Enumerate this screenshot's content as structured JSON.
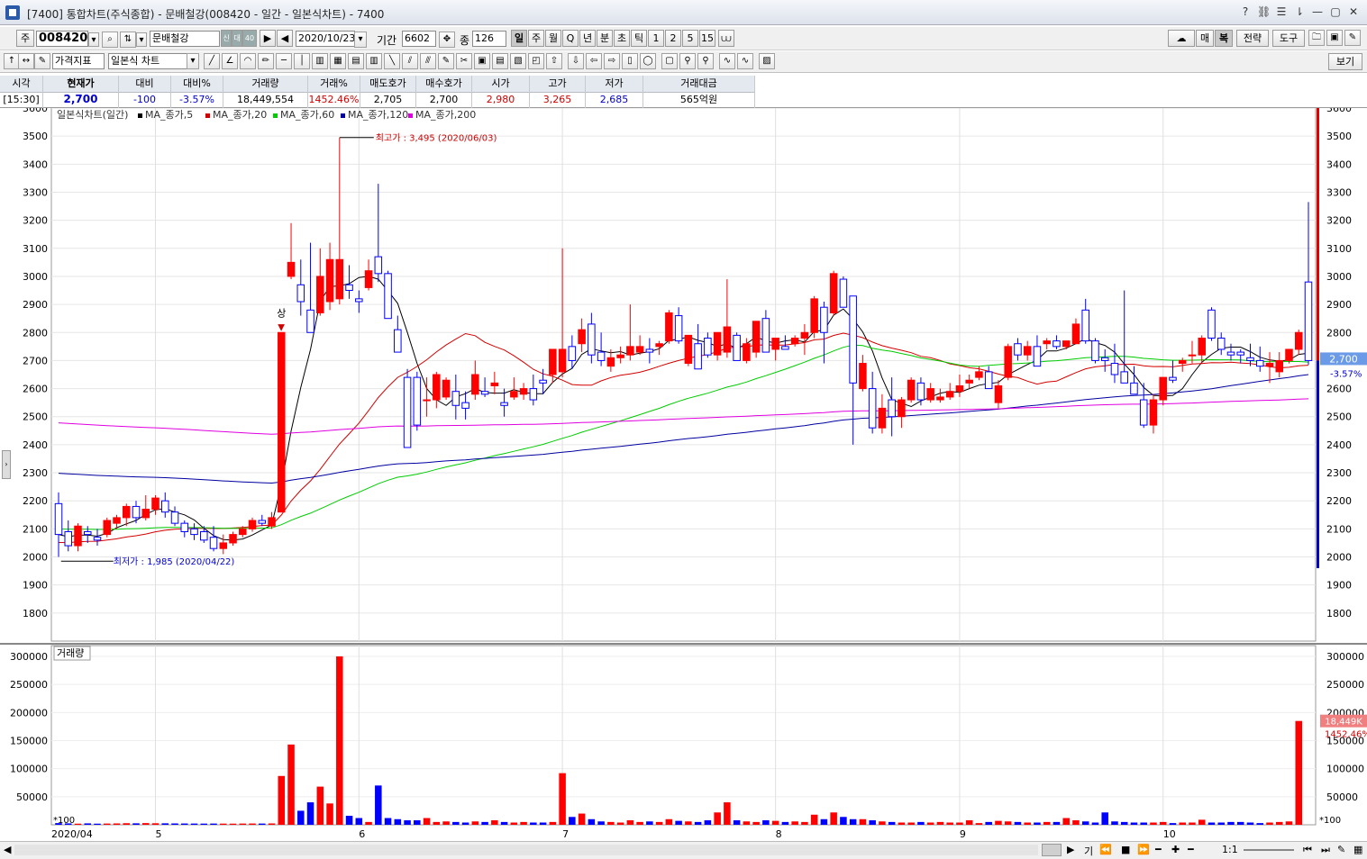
{
  "window": {
    "title": "[7400] 통합차트(주식종합) - 문배철강(008420 - 일간 - 일본식차트) - 7400"
  },
  "toolbar1": {
    "market_btn": "주",
    "code": "008420",
    "stock_name": "문배철강",
    "badge1": "신",
    "badge2": "대",
    "badge3": "40",
    "date": "2020/10/23",
    "period_label": "기간",
    "period_value": "6602",
    "count_label": "종",
    "count_value": "126",
    "period_buttons": [
      "일",
      "주",
      "월",
      "Q",
      "년",
      "분",
      "초",
      "틱",
      "1",
      "2",
      "5",
      "15"
    ],
    "right_buttons": [
      "매",
      "복",
      "전략",
      "도구"
    ]
  },
  "toolbar2": {
    "indicator_select": "가격지표",
    "chart_type_select": "일본식 차트",
    "view_button": "보기"
  },
  "quote": {
    "headers": [
      "시각",
      "현재가",
      "대비",
      "대비%",
      "거래량",
      "거래%",
      "매도호가",
      "매수호가",
      "시가",
      "고가",
      "저가",
      "거래대금"
    ],
    "values": [
      "[15:30]",
      "2,700",
      "-100",
      "-3.57%",
      "18,449,554",
      "1452.46%",
      "2,705",
      "2,700",
      "2,980",
      "3,265",
      "2,685",
      "565억원"
    ]
  },
  "colors": {
    "up": "#ff0000",
    "down": "#0000ff",
    "ma5": "#000000",
    "ma20": "#d40000",
    "ma60": "#00cc00",
    "ma120": "#0000a0",
    "ma200": "#e000e0"
  },
  "chart_data": {
    "type": "candlestick",
    "title": "일본식차트(일간)",
    "legend": [
      "MA_종가,5",
      "MA_종가,20",
      "MA_종가,60",
      "MA_종가,120",
      "MA_종가,200"
    ],
    "x_labels": [
      "2020/04",
      "5",
      "6",
      "7",
      "8",
      "9",
      "10"
    ],
    "ylim": [
      1700,
      3600
    ],
    "y_ticks": [
      1800,
      1900,
      2000,
      2100,
      2200,
      2300,
      2400,
      2500,
      2600,
      2700,
      2800,
      2900,
      3000,
      3100,
      3200,
      3300,
      3400,
      3500,
      3600
    ],
    "annotations": {
      "high": "최고가 : 3,495 (2020/06/03)",
      "low": "최저가 : 1,985 (2020/04/22)",
      "limit_up": "상"
    },
    "current_price": "2,700",
    "current_change": "-3.57%",
    "candles": [
      [
        2190,
        2230,
        2000,
        2080
      ],
      [
        2090,
        2130,
        2020,
        2040
      ],
      [
        2040,
        2120,
        2020,
        2110
      ],
      [
        2090,
        2110,
        2050,
        2080
      ],
      [
        2070,
        2100,
        2040,
        2060
      ],
      [
        2080,
        2140,
        2070,
        2130
      ],
      [
        2120,
        2150,
        2100,
        2140
      ],
      [
        2140,
        2190,
        2110,
        2180
      ],
      [
        2180,
        2200,
        2120,
        2140
      ],
      [
        2140,
        2220,
        2130,
        2170
      ],
      [
        2170,
        2220,
        2150,
        2210
      ],
      [
        2200,
        2230,
        2140,
        2160
      ],
      [
        2160,
        2180,
        2110,
        2120
      ],
      [
        2120,
        2130,
        2070,
        2090
      ],
      [
        2100,
        2120,
        2060,
        2080
      ],
      [
        2090,
        2110,
        2050,
        2060
      ],
      [
        2070,
        2110,
        2020,
        2030
      ],
      [
        2030,
        2080,
        2010,
        2050
      ],
      [
        2050,
        2090,
        2040,
        2080
      ],
      [
        2080,
        2110,
        2070,
        2100
      ],
      [
        2100,
        2140,
        2090,
        2130
      ],
      [
        2130,
        2150,
        2110,
        2120
      ],
      [
        2110,
        2160,
        2100,
        2140
      ],
      [
        2160,
        2800,
        2160,
        2800
      ],
      [
        3000,
        3190,
        2990,
        3050
      ],
      [
        2970,
        3060,
        2860,
        2910
      ],
      [
        2880,
        3120,
        2850,
        2800
      ],
      [
        2870,
        3100,
        2860,
        3000
      ],
      [
        2910,
        3120,
        2880,
        3060
      ],
      [
        2920,
        3495,
        2900,
        3060
      ],
      [
        2970,
        3040,
        2920,
        2950
      ],
      [
        2920,
        2950,
        2870,
        2910
      ],
      [
        2960,
        3060,
        2950,
        3020
      ],
      [
        3070,
        3330,
        2980,
        3010
      ],
      [
        3010,
        3020,
        2860,
        2850
      ],
      [
        2810,
        2860,
        2780,
        2730
      ],
      [
        2640,
        2670,
        2390,
        2390
      ],
      [
        2640,
        2660,
        2450,
        2470
      ],
      [
        2560,
        2640,
        2500,
        2560
      ],
      [
        2560,
        2660,
        2530,
        2650
      ],
      [
        2570,
        2640,
        2560,
        2630
      ],
      [
        2590,
        2650,
        2490,
        2540
      ],
      [
        2550,
        2590,
        2490,
        2530
      ],
      [
        2580,
        2700,
        2560,
        2650
      ],
      [
        2590,
        2640,
        2570,
        2580
      ],
      [
        2610,
        2660,
        2580,
        2620
      ],
      [
        2550,
        2600,
        2500,
        2540
      ],
      [
        2570,
        2640,
        2560,
        2590
      ],
      [
        2580,
        2620,
        2560,
        2600
      ],
      [
        2600,
        2650,
        2540,
        2560
      ],
      [
        2630,
        2670,
        2580,
        2620
      ],
      [
        2650,
        2710,
        2620,
        2740
      ],
      [
        2660,
        3100,
        2640,
        2740
      ],
      [
        2750,
        2790,
        2670,
        2700
      ],
      [
        2760,
        2850,
        2730,
        2810
      ],
      [
        2830,
        2870,
        2690,
        2720
      ],
      [
        2730,
        2800,
        2680,
        2700
      ],
      [
        2680,
        2740,
        2660,
        2710
      ],
      [
        2710,
        2750,
        2690,
        2720
      ],
      [
        2720,
        2900,
        2700,
        2750
      ],
      [
        2730,
        2790,
        2720,
        2750
      ],
      [
        2740,
        2780,
        2690,
        2730
      ],
      [
        2750,
        2770,
        2720,
        2760
      ],
      [
        2770,
        2880,
        2760,
        2870
      ],
      [
        2860,
        2890,
        2760,
        2770
      ],
      [
        2690,
        2790,
        2680,
        2790
      ],
      [
        2760,
        2830,
        2670,
        2670
      ],
      [
        2780,
        2800,
        2710,
        2720
      ],
      [
        2720,
        2790,
        2700,
        2800
      ],
      [
        2730,
        2990,
        2710,
        2820
      ],
      [
        2790,
        2800,
        2720,
        2700
      ],
      [
        2700,
        2780,
        2690,
        2760
      ],
      [
        2730,
        2810,
        2710,
        2840
      ],
      [
        2850,
        2880,
        2730,
        2730
      ],
      [
        2740,
        2760,
        2700,
        2780
      ],
      [
        2750,
        2790,
        2740,
        2740
      ],
      [
        2760,
        2790,
        2750,
        2780
      ],
      [
        2780,
        2830,
        2720,
        2800
      ],
      [
        2800,
        2930,
        2780,
        2920
      ],
      [
        2890,
        2910,
        2690,
        2800
      ],
      [
        2870,
        3020,
        2860,
        3010
      ],
      [
        2990,
        3000,
        2900,
        2890
      ],
      [
        2930,
        2930,
        2400,
        2620
      ],
      [
        2600,
        2720,
        2590,
        2690
      ],
      [
        2600,
        2660,
        2440,
        2460
      ],
      [
        2460,
        2580,
        2440,
        2530
      ],
      [
        2560,
        2640,
        2430,
        2500
      ],
      [
        2500,
        2570,
        2460,
        2560
      ],
      [
        2560,
        2640,
        2550,
        2630
      ],
      [
        2620,
        2640,
        2540,
        2560
      ],
      [
        2560,
        2620,
        2550,
        2600
      ],
      [
        2560,
        2600,
        2550,
        2570
      ],
      [
        2570,
        2620,
        2560,
        2590
      ],
      [
        2590,
        2650,
        2570,
        2610
      ],
      [
        2620,
        2650,
        2600,
        2630
      ],
      [
        2640,
        2680,
        2630,
        2660
      ],
      [
        2660,
        2680,
        2600,
        2600
      ],
      [
        2550,
        2630,
        2530,
        2610
      ],
      [
        2640,
        2760,
        2630,
        2750
      ],
      [
        2760,
        2780,
        2700,
        2720
      ],
      [
        2720,
        2770,
        2700,
        2750
      ],
      [
        2750,
        2790,
        2730,
        2680
      ],
      [
        2760,
        2780,
        2740,
        2770
      ],
      [
        2770,
        2790,
        2740,
        2750
      ],
      [
        2750,
        2770,
        2740,
        2770
      ],
      [
        2760,
        2850,
        2760,
        2830
      ],
      [
        2880,
        2920,
        2760,
        2770
      ],
      [
        2770,
        2780,
        2690,
        2700
      ],
      [
        2710,
        2740,
        2660,
        2700
      ],
      [
        2690,
        2760,
        2620,
        2650
      ],
      [
        2660,
        2950,
        2630,
        2620
      ],
      [
        2620,
        2680,
        2580,
        2580
      ],
      [
        2560,
        2620,
        2460,
        2470
      ],
      [
        2470,
        2580,
        2440,
        2560
      ],
      [
        2560,
        2640,
        2540,
        2640
      ],
      [
        2640,
        2700,
        2620,
        2630
      ],
      [
        2690,
        2710,
        2660,
        2700
      ],
      [
        2720,
        2770,
        2690,
        2720
      ],
      [
        2720,
        2790,
        2690,
        2780
      ],
      [
        2880,
        2890,
        2770,
        2780
      ],
      [
        2780,
        2800,
        2720,
        2740
      ],
      [
        2730,
        2760,
        2700,
        2720
      ],
      [
        2730,
        2740,
        2690,
        2720
      ],
      [
        2710,
        2760,
        2680,
        2700
      ],
      [
        2700,
        2750,
        2660,
        2680
      ],
      [
        2680,
        2730,
        2620,
        2690
      ],
      [
        2660,
        2730,
        2640,
        2700
      ],
      [
        2700,
        2740,
        2690,
        2740
      ],
      [
        2740,
        2810,
        2720,
        2800
      ],
      [
        2980,
        3265,
        2685,
        2700
      ]
    ],
    "volume": {
      "title": "거래량",
      "ylim": [
        0,
        300000
      ],
      "y_ticks": [
        50000,
        100000,
        150000,
        200000,
        250000,
        300000
      ],
      "unit_label": "*100",
      "current_value": "18,449K",
      "current_pct": "1452.46%",
      "values": [
        3000,
        2500,
        2000,
        2500,
        2000,
        2200,
        2400,
        2800,
        2600,
        3000,
        2700,
        2600,
        2400,
        2300,
        2200,
        2100,
        2200,
        2100,
        2000,
        2200,
        2300,
        2200,
        2400,
        87000,
        143000,
        25000,
        40000,
        68000,
        38000,
        300000,
        16000,
        12000,
        5000,
        70000,
        12000,
        10000,
        8000,
        8000,
        12000,
        5000,
        6000,
        5000,
        4000,
        6000,
        5000,
        8000,
        5000,
        4000,
        5000,
        4000,
        4000,
        5000,
        92000,
        14000,
        20000,
        10000,
        6000,
        5000,
        4000,
        8000,
        5000,
        6000,
        5000,
        10000,
        7000,
        6000,
        5000,
        8000,
        22000,
        40000,
        8000,
        6000,
        5000,
        8000,
        7000,
        5000,
        6000,
        5000,
        18000,
        10000,
        22000,
        14000,
        10000,
        10000,
        8000,
        6000,
        5000,
        4000,
        4000,
        5000,
        4000,
        5000,
        4000,
        4000,
        8000,
        3000,
        5000,
        7000,
        6000,
        5000,
        4000,
        4000,
        5000,
        5000,
        12000,
        8000,
        6000,
        4000,
        22000,
        6000,
        5000,
        4000,
        4000,
        4000,
        5000,
        3000,
        4000,
        4000,
        9000,
        4000,
        4000,
        5000,
        5000,
        4000,
        3000,
        4000,
        5000,
        6000,
        185000
      ]
    }
  },
  "bottom": {
    "zoom_label": "1:1",
    "label_gi": "기"
  }
}
